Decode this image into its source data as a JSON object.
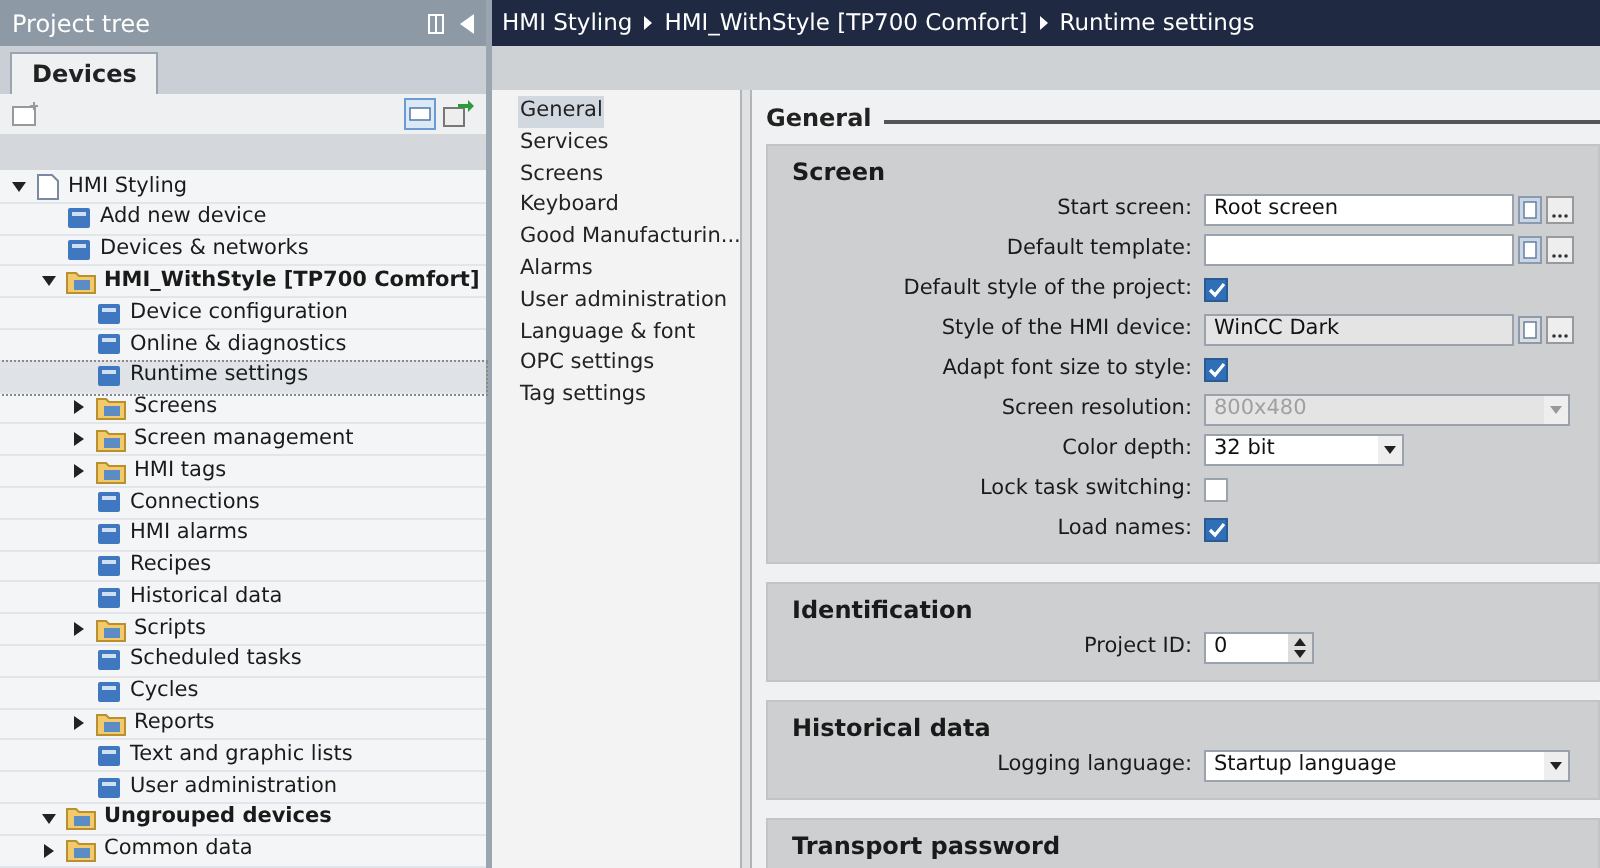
{
  "project_tree": {
    "title": "Project tree",
    "tabs": [
      {
        "label": "Devices",
        "selected": true
      }
    ],
    "items": [
      {
        "label": "HMI Styling",
        "kind": "project",
        "expanded": true,
        "selected": false,
        "children": [
          {
            "label": "Add new device",
            "kind": "leaf",
            "selected": false
          },
          {
            "label": "Devices & networks",
            "kind": "leaf",
            "selected": false
          },
          {
            "label": "HMI_WithStyle [TP700 Comfort]",
            "kind": "device",
            "expanded": true,
            "selected": false,
            "children": [
              {
                "label": "Device configuration",
                "kind": "leaf",
                "selected": false
              },
              {
                "label": "Online & diagnostics",
                "kind": "leaf",
                "selected": false
              },
              {
                "label": "Runtime settings",
                "kind": "leaf",
                "selected": true
              },
              {
                "label": "Screens",
                "kind": "folder",
                "expanded": false,
                "selected": false
              },
              {
                "label": "Screen management",
                "kind": "folder",
                "expanded": false,
                "selected": false
              },
              {
                "label": "HMI tags",
                "kind": "folder",
                "expanded": false,
                "selected": false
              },
              {
                "label": "Connections",
                "kind": "leaf",
                "selected": false
              },
              {
                "label": "HMI alarms",
                "kind": "leaf",
                "selected": false
              },
              {
                "label": "Recipes",
                "kind": "leaf",
                "selected": false
              },
              {
                "label": "Historical data",
                "kind": "leaf",
                "selected": false
              },
              {
                "label": "Scripts",
                "kind": "folder",
                "expanded": false,
                "selected": false
              },
              {
                "label": "Scheduled tasks",
                "kind": "leaf",
                "selected": false
              },
              {
                "label": "Cycles",
                "kind": "leaf",
                "selected": false
              },
              {
                "label": "Reports",
                "kind": "folder",
                "expanded": false,
                "selected": false
              },
              {
                "label": "Text and graphic lists",
                "kind": "leaf",
                "selected": false
              },
              {
                "label": "User administration",
                "kind": "leaf",
                "selected": false
              }
            ]
          },
          {
            "label": "Ungrouped devices",
            "kind": "device",
            "expanded": true,
            "selected": false
          },
          {
            "label": "Common data",
            "kind": "folder",
            "expanded": false,
            "selected": false
          }
        ]
      }
    ]
  },
  "breadcrumb": [
    "HMI Styling",
    "HMI_WithStyle [TP700 Comfort]",
    "Runtime settings"
  ],
  "nav": [
    {
      "label": "General",
      "selected": true
    },
    {
      "label": "Services",
      "selected": false
    },
    {
      "label": "Screens",
      "selected": false
    },
    {
      "label": "Keyboard",
      "selected": false
    },
    {
      "label": "Good Manufacturin...",
      "selected": false
    },
    {
      "label": "Alarms",
      "selected": false
    },
    {
      "label": "User administration",
      "selected": false
    },
    {
      "label": "Language & font",
      "selected": false
    },
    {
      "label": "OPC settings",
      "selected": false
    },
    {
      "label": "Tag settings",
      "selected": false
    }
  ],
  "heading": "General",
  "sections": [
    {
      "title": "Screen",
      "rows": [
        {
          "label": "Start screen:",
          "kind": "browse",
          "value": "Root screen",
          "disabled": false
        },
        {
          "label": "Default template:",
          "kind": "browse",
          "value": "",
          "disabled": false
        },
        {
          "label": "Default style of the project:",
          "kind": "checkbox",
          "checked": true
        },
        {
          "label": "Style of the HMI device:",
          "kind": "browse",
          "value": "WinCC Dark",
          "disabled": true
        },
        {
          "label": "Adapt font size to style:",
          "kind": "checkbox",
          "checked": true
        },
        {
          "label": "Screen resolution:",
          "kind": "dropdown",
          "value": "800x480",
          "disabled": true
        },
        {
          "label": "Color depth:",
          "kind": "short-dropdown",
          "value": "32 bit",
          "disabled": false
        },
        {
          "label": "Lock task switching:",
          "kind": "checkbox",
          "checked": false
        },
        {
          "label": "Load names:",
          "kind": "checkbox",
          "checked": true
        }
      ]
    },
    {
      "title": "Identification",
      "rows": [
        {
          "label": "Project ID:",
          "kind": "spinner",
          "value": "0"
        }
      ]
    },
    {
      "title": "Historical data",
      "rows": [
        {
          "label": "Logging language:",
          "kind": "dropdown",
          "value": "Startup language",
          "disabled": false
        }
      ]
    },
    {
      "title": "Transport password"
    }
  ]
}
